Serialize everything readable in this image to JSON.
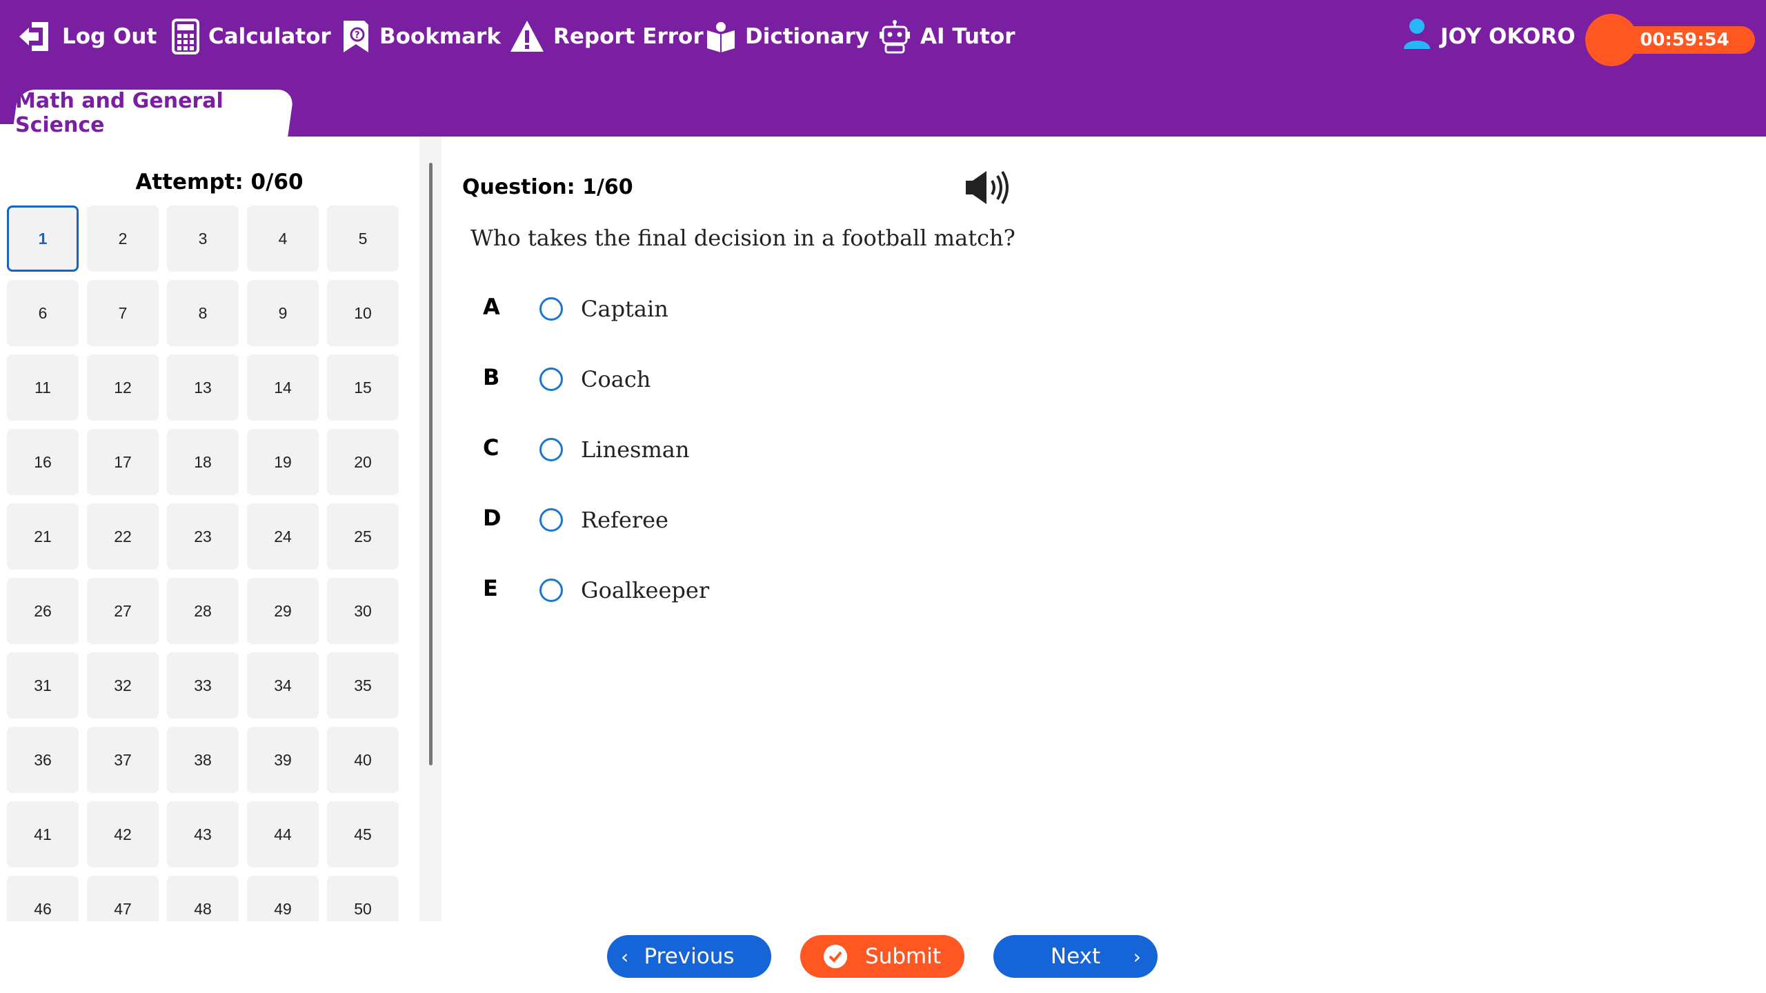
{
  "toolbar": {
    "logout": "Log Out",
    "calculator": "Calculator",
    "bookmark": "Bookmark",
    "report_error": "Report Error",
    "dictionary": "Dictionary",
    "ai_tutor": "AI Tutor"
  },
  "user": {
    "name": "JOY OKORO"
  },
  "timer": "00:59:54",
  "subject_tab": "Math and General Science",
  "navigator": {
    "attempt_label": "Attempt: 0/60",
    "current": 1,
    "visible_numbers": [
      "1",
      "2",
      "3",
      "4",
      "5",
      "6",
      "7",
      "8",
      "9",
      "10",
      "11",
      "12",
      "13",
      "14",
      "15",
      "16",
      "17",
      "18",
      "19",
      "20",
      "21",
      "22",
      "23",
      "24",
      "25",
      "26",
      "27",
      "28",
      "29",
      "30",
      "31",
      "32",
      "33",
      "34",
      "35",
      "36",
      "37",
      "38",
      "39",
      "40",
      "41",
      "42",
      "43",
      "44",
      "45",
      "46",
      "47",
      "48",
      "49",
      "50"
    ]
  },
  "question": {
    "number_label": "Question: 1/60",
    "text": "Who takes the final decision in a football match?",
    "options": [
      {
        "letter": "A",
        "text": "Captain"
      },
      {
        "letter": "B",
        "text": "Coach"
      },
      {
        "letter": "C",
        "text": "Linesman"
      },
      {
        "letter": "D",
        "text": "Referee"
      },
      {
        "letter": "E",
        "text": "Goalkeeper"
      }
    ]
  },
  "buttons": {
    "previous": "Previous",
    "submit": "Submit",
    "next": "Next"
  },
  "colors": {
    "header": "#7b1fa2",
    "accent_blue": "#1565d8",
    "accent_orange": "#ff5722"
  },
  "icons": [
    "logout-icon",
    "calculator-icon",
    "bookmark-icon",
    "warning-icon",
    "book-icon",
    "robot-icon",
    "user-icon",
    "speaker-icon",
    "check-icon"
  ]
}
